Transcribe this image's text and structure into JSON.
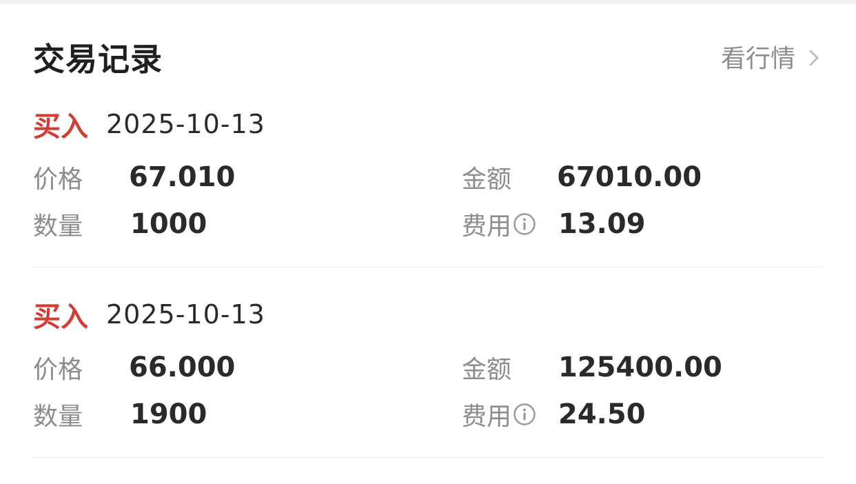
{
  "header": {
    "title": "交易记录",
    "market_link_label": "看行情"
  },
  "records": [
    {
      "type": "买入",
      "date": "2025-10-13",
      "price_label": "价格",
      "price": "67.010",
      "amount_label": "金额",
      "amount": "67010.00",
      "quantity_label": "数量",
      "quantity": "1000",
      "fee_label": "费用",
      "fee": "13.09"
    },
    {
      "type": "买入",
      "date": "2025-10-13",
      "price_label": "价格",
      "price": "66.000",
      "amount_label": "金额",
      "amount": "125400.00",
      "quantity_label": "数量",
      "quantity": "1900",
      "fee_label": "费用",
      "fee": "24.50"
    }
  ],
  "colors": {
    "buy": "#d43c33",
    "label": "#8c8c8c",
    "value": "#2a2a2a"
  }
}
